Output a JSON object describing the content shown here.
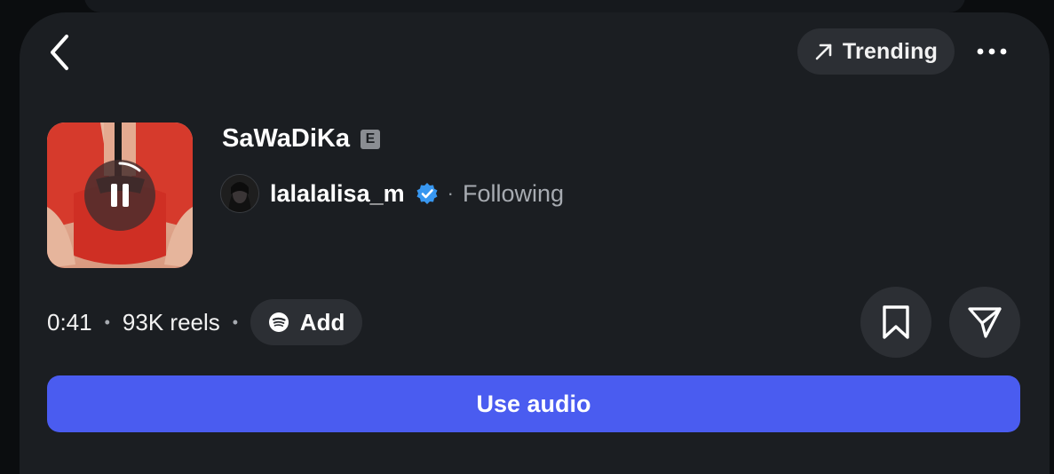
{
  "header": {
    "trending_label": "Trending"
  },
  "song": {
    "title": "SaWaDiKa",
    "explicit_badge": "E",
    "artist": "lalalalisa_m",
    "follow_status": "Following",
    "duration": "0:41",
    "reels_count": "93K reels",
    "add_label": "Add"
  },
  "actions": {
    "use_audio_label": "Use audio"
  },
  "colors": {
    "accent": "#4a5cf0",
    "verified": "#3897f0",
    "sheet_bg": "#1b1e22",
    "pill_bg": "#2c2f34"
  },
  "icons": {
    "back": "chevron-left-icon",
    "trending": "arrow-up-right-icon",
    "more": "more-horizontal-icon",
    "pause": "pause-icon",
    "verified": "verified-badge-icon",
    "spotify": "spotify-icon",
    "save": "bookmark-icon",
    "share": "send-icon"
  }
}
